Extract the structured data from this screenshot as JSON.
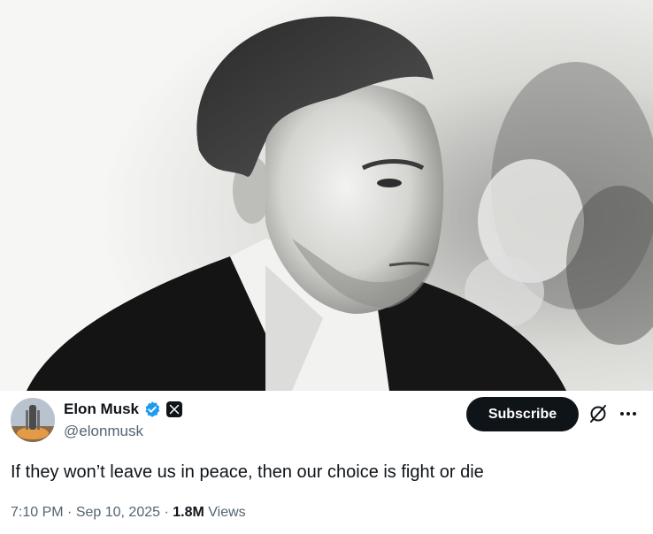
{
  "photo": {
    "subject": "portrait-photo"
  },
  "author": {
    "display_name": "Elon Musk",
    "handle": "@elonmusk",
    "verified_color": "#1d9bf0",
    "affiliation_icon": "x-logo-icon",
    "avatar_icon": "rocket-launch-icon"
  },
  "actions": {
    "subscribe_label": "Subscribe",
    "grok_icon": "grok-icon",
    "more_icon": "more-icon"
  },
  "tweet": {
    "text": "If they won’t leave us in peace, then our choice is fight or die"
  },
  "meta": {
    "time": "7:10 PM",
    "separator": " · ",
    "date": "Sep 10, 2025",
    "views_count": "1.8M",
    "views_label": "Views"
  },
  "colors": {
    "text_primary": "#0f1419",
    "text_secondary": "#536471",
    "button_bg": "#0f1419"
  }
}
